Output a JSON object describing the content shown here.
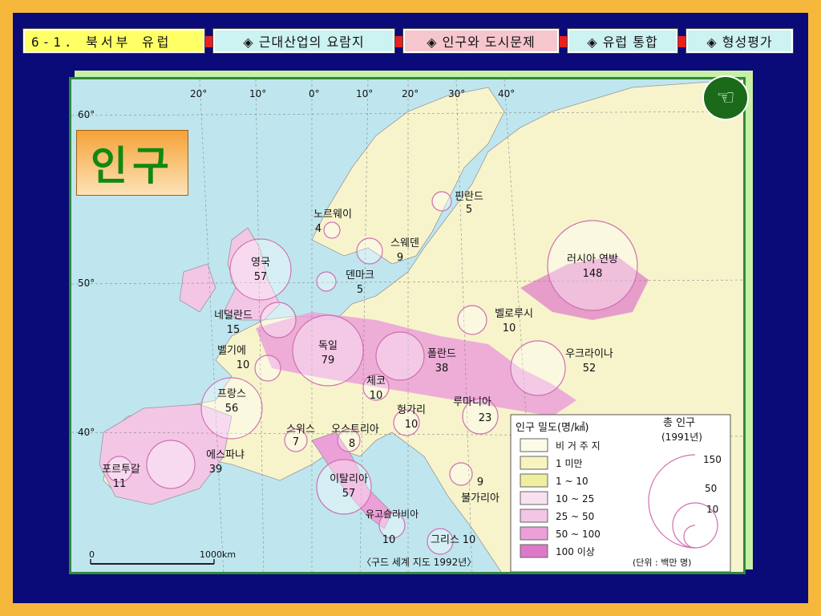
{
  "nav": {
    "title": "6-1. 북서부 유럽",
    "tabs": [
      {
        "label": "◈ 근대산업의 요람지",
        "active": false
      },
      {
        "label": "◈ 인구와 도시문제",
        "active": true
      },
      {
        "label": "◈ 유럽 통합",
        "active": false
      },
      {
        "label": "◈ 형성평가",
        "active": false
      }
    ]
  },
  "slide_label": "인구",
  "back_icon": "☜",
  "map": {
    "longitudes": [
      "20°",
      "10°",
      "0°",
      "10°",
      "20°",
      "30°",
      "40°"
    ],
    "latitudes": [
      "60°",
      "50°",
      "40°"
    ],
    "countries": [
      {
        "name": "핀란드",
        "value": "5"
      },
      {
        "name": "노르웨이",
        "value": "4"
      },
      {
        "name": "스웨덴",
        "value": "9"
      },
      {
        "name": "영국",
        "value": "57"
      },
      {
        "name": "덴마크",
        "value": "5"
      },
      {
        "name": "러시아 연방",
        "value": "148"
      },
      {
        "name": "네덜란드",
        "value": "15"
      },
      {
        "name": "벨로루시",
        "value": "10"
      },
      {
        "name": "독일",
        "value": "79"
      },
      {
        "name": "폴란드",
        "value": "38"
      },
      {
        "name": "벨기에",
        "value": "10"
      },
      {
        "name": "우크라이나",
        "value": "52"
      },
      {
        "name": "체코",
        "value": "10"
      },
      {
        "name": "프랑스",
        "value": "56"
      },
      {
        "name": "헝가리",
        "value": "10"
      },
      {
        "name": "루마니아",
        "value": "23"
      },
      {
        "name": "스위스",
        "value": "7"
      },
      {
        "name": "오스트리아",
        "value": "8"
      },
      {
        "name": "에스파냐",
        "value": "39"
      },
      {
        "name": "포르투갈",
        "value": "11"
      },
      {
        "name": "이탈리아",
        "value": "57"
      },
      {
        "name": "불가리아",
        "value": "9"
      },
      {
        "name": "유고슬라비아",
        "value": "10"
      },
      {
        "name": "그리스",
        "value": "10"
      }
    ],
    "scale": {
      "start": "0",
      "end": "1000km"
    },
    "source": "〈구드 세계 지도 1992년〉"
  },
  "legend": {
    "density_title": "인구 밀도(명/㎢)",
    "total_title": "총 인구",
    "total_year": "(1991년)",
    "classes": [
      {
        "label": "비 거 주 지",
        "color": "#fbfbe8"
      },
      {
        "label": "1  미만",
        "color": "#f7f4c0"
      },
      {
        "label": "1 ~  10",
        "color": "#f0efa0"
      },
      {
        "label": "10 ~  25",
        "color": "#f8e2f0"
      },
      {
        "label": "25 ~  50",
        "color": "#f3c6e6"
      },
      {
        "label": "50 ~ 100",
        "color": "#eba0d8"
      },
      {
        "label": "100  이상",
        "color": "#de78c8"
      }
    ],
    "circle_values": [
      "150",
      "50",
      "10"
    ],
    "unit": "(단위 : 백만 명)"
  }
}
